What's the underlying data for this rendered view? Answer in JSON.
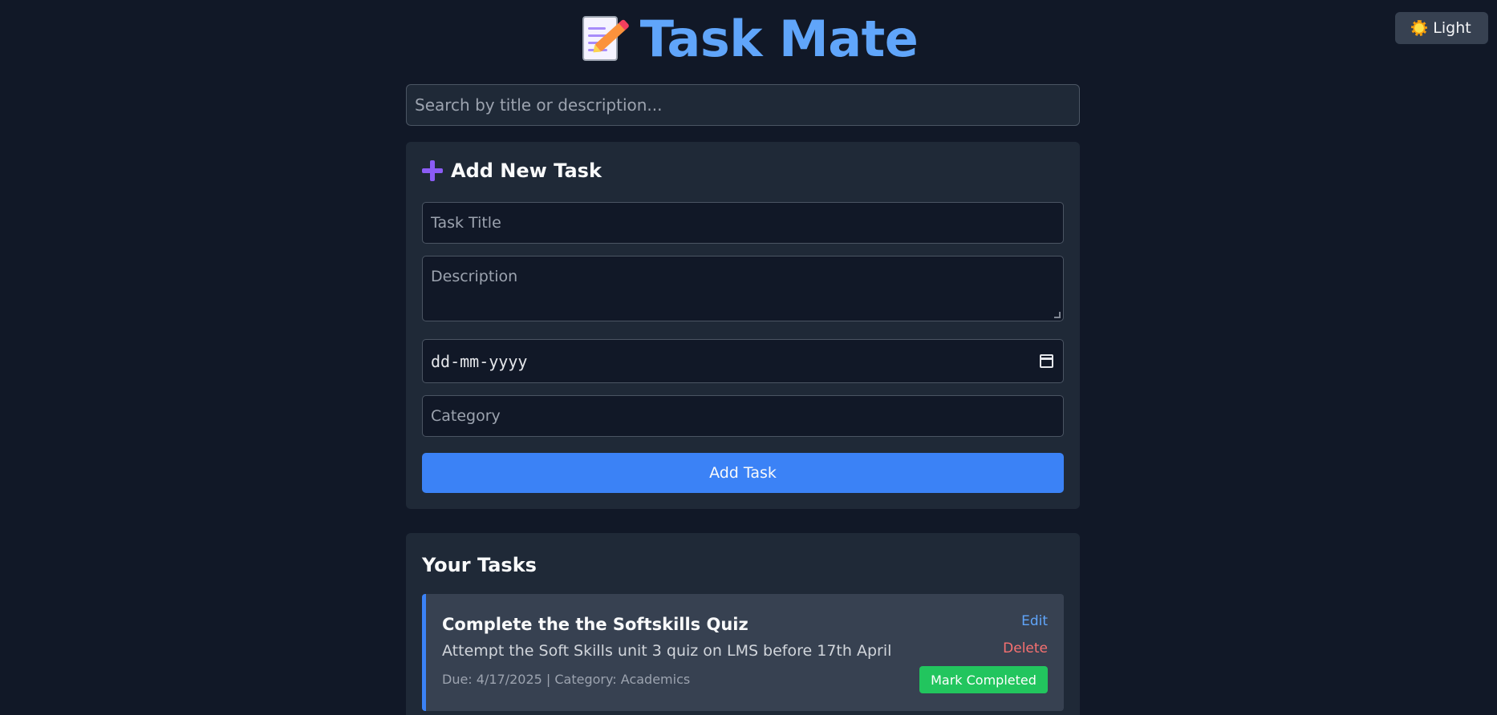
{
  "theme_toggle": {
    "label": "Light",
    "icon": "sun-icon"
  },
  "header": {
    "title": "Task Mate",
    "icon": "memo-icon"
  },
  "search": {
    "placeholder": "Search by title or description..."
  },
  "add_task": {
    "heading": "Add New Task",
    "icon": "plus-icon",
    "title_placeholder": "Task Title",
    "description_placeholder": "Description",
    "date_placeholder": "dd-mm-yyyy",
    "category_placeholder": "Category",
    "submit_label": "Add Task"
  },
  "task_list": {
    "heading": "Your Tasks",
    "tasks": [
      {
        "title": "Complete the the Softskills Quiz",
        "description": "Attempt the Soft Skills unit 3 quiz on LMS before 17th April",
        "meta": "Due: 4/17/2025 | Category: Academics",
        "edit_label": "Edit",
        "delete_label": "Delete",
        "complete_label": "Mark Completed"
      }
    ]
  },
  "colors": {
    "background": "#111827",
    "card": "#1f2937",
    "accent": "#3b82f6",
    "title": "#60a5fa",
    "success": "#22c55e",
    "danger": "#f87171"
  }
}
